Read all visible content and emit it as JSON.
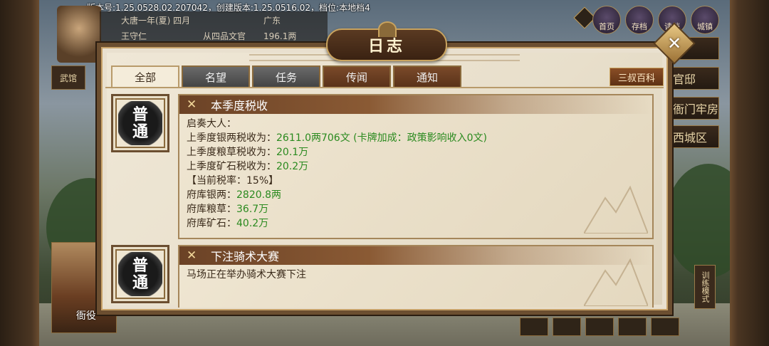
{
  "version_info": "版本号:1.25.0528.02.207042，创建版本:1.25.0516.02，档位:本地档4",
  "info_bar": {
    "row1": {
      "c1": "大唐一年(夏) 四月",
      "c2": "",
      "c3": "广东"
    },
    "row2": {
      "c1": "王守仁",
      "c2": "从四品文官",
      "c3": "196.1两"
    }
  },
  "background": {
    "left_button": "武馆",
    "top_icons": [
      {
        "name": "ranking-icon",
        "label": "首页"
      },
      {
        "name": "save-icon",
        "label": "存档"
      },
      {
        "name": "read-icon",
        "label": "读档"
      },
      {
        "name": "town-icon",
        "label": "城镇"
      }
    ],
    "right_menu": [
      "",
      "官邸",
      "衙门牢房",
      "西城区"
    ],
    "bottom_avatar_label": "衙役",
    "train_mode": "训练模式"
  },
  "dialog": {
    "title": "日志",
    "close_symbol": "✕",
    "tabs": [
      {
        "label": "全部",
        "style": "active"
      },
      {
        "label": "名望",
        "style": "gray"
      },
      {
        "label": "任务",
        "style": "gray"
      },
      {
        "label": "传闻",
        "style": "brown"
      },
      {
        "label": "通知",
        "style": "brown"
      }
    ],
    "wiki_button": "三叔百科",
    "entries": [
      {
        "seal": [
          "普",
          "通"
        ],
        "title": "本季度税收",
        "lines": [
          {
            "label": "启奏大人：",
            "value": ""
          },
          {
            "label": "上季度银两税收为：",
            "value": "2611.0两706文 (卡牌加成：政策影响收入0文)"
          },
          {
            "label": "上季度粮草税收为：",
            "value": "20.1万"
          },
          {
            "label": "上季度矿石税收为：",
            "value": "20.2万"
          },
          {
            "label": "【当前税率：15%】",
            "value": ""
          },
          {
            "label": "府库银两：",
            "value": "2820.8两"
          },
          {
            "label": "府库粮草：",
            "value": "36.7万"
          },
          {
            "label": "府库矿石：",
            "value": "40.2万"
          }
        ]
      },
      {
        "seal": [
          "普",
          "通"
        ],
        "title": "下注骑术大赛",
        "lines": [
          {
            "label": "马场正在举办骑术大赛下注",
            "value": ""
          }
        ]
      }
    ]
  },
  "colors": {
    "accent_brown": "#6b4226",
    "value_green": "#2a8a1f",
    "parchment": "#e9e0cf"
  }
}
